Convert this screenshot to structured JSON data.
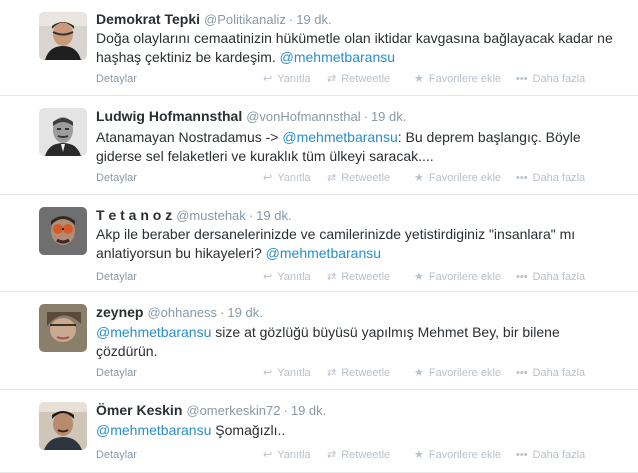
{
  "tweets": [
    {
      "fullname": "Demokrat Tepki",
      "username": "@Politikanaliz",
      "sep": "·",
      "time": "19 dk.",
      "text_before": "Doğa olaylarını cemaatinizin hükümetle olan iktidar kavgasına bağlayacak kadar ne haşhaş çektiniz be kardeşim. ",
      "mention": "@mehmetbaransu",
      "text_after": ""
    },
    {
      "fullname": "Ludwig Hofmannsthal",
      "username": "@vonHofmannsthal",
      "sep": "·",
      "time": "19 dk.",
      "text_before": "Atanamayan Nostradamus -> ",
      "mention": "@mehmetbaransu",
      "text_after": ": Bu deprem başlangıç. Böyle giderse sel felaketleri ve kuraklık tüm ülkeyi saracak...."
    },
    {
      "fullname": "T e t a n o z",
      "username": "@mustehak",
      "sep": "·",
      "time": "19 dk.",
      "text_before": "Akp ile beraber dersanelerinizde ve camilerinizde yetistirdiginiz \"insanlara\" mı anlatiyorsun bu hikayeleri? ",
      "mention": "@mehmetbaransu",
      "text_after": ""
    },
    {
      "fullname": "zeynep",
      "username": "@ohhaness",
      "sep": "·",
      "time": "19 dk.",
      "text_before": "",
      "mention": "@mehmetbaransu",
      "text_after": " size at gözlüğü büyüsü yapılmış Mehmet Bey, bir bilene çözdürün."
    },
    {
      "fullname": "Ömer Keskin",
      "username": "@omerkeskin72",
      "sep": "·",
      "time": "19 dk.",
      "text_before": "",
      "mention": "@mehmetbaransu",
      "text_after": " Şomağızlı.."
    }
  ],
  "actions": {
    "details": "Detaylar",
    "reply": "Yanıtla",
    "retweet": "Retweetle",
    "favorite": "Favorilere ekle",
    "more": "Daha fazla"
  },
  "icons": {
    "reply": "reply-icon",
    "retweet": "retweet-icon",
    "favorite": "star-icon",
    "more": "more-dots-icon"
  }
}
